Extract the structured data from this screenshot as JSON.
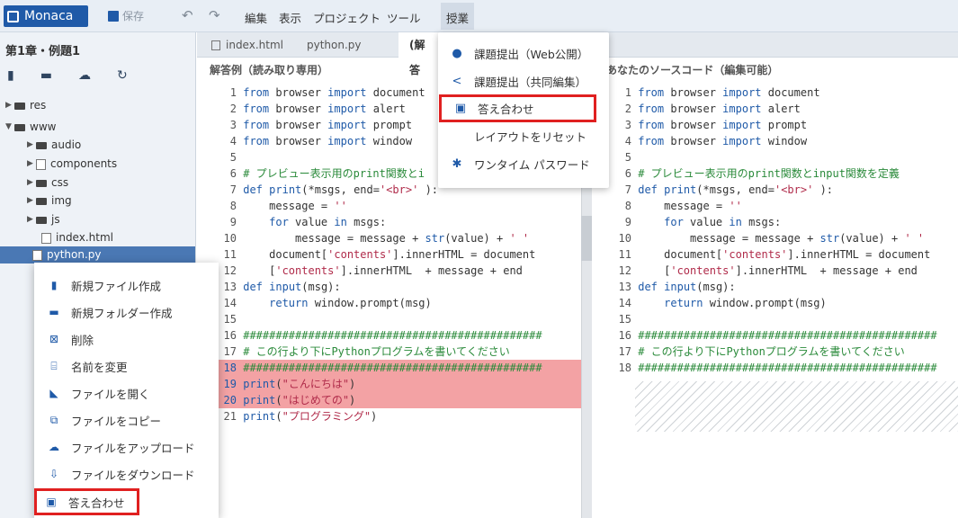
{
  "app": {
    "brand": "Monaca",
    "save_label": "保存"
  },
  "menubar": [
    "編集",
    "表示",
    "プロジェクト",
    "ツール",
    "授業"
  ],
  "sidebar": {
    "project": "第1章・例題1",
    "toolbar_icons": [
      "new-file-icon",
      "new-folder-icon",
      "upload-icon",
      "refresh-icon"
    ],
    "tree": [
      {
        "label": "res",
        "type": "folder"
      },
      {
        "label": "www",
        "type": "folder"
      },
      {
        "label": "audio",
        "type": "folder"
      },
      {
        "label": "components",
        "type": "folder"
      },
      {
        "label": "css",
        "type": "folder"
      },
      {
        "label": "img",
        "type": "folder"
      },
      {
        "label": "js",
        "type": "folder"
      },
      {
        "label": "index.html",
        "type": "file"
      },
      {
        "label": "python.py",
        "type": "file",
        "selected": true
      }
    ]
  },
  "tabs": [
    "index.html",
    "python.py",
    "(解答"
  ],
  "panes": {
    "left_title": "解答例（読み取り専用）",
    "right_title": "あなたのソースコード（編集可能）"
  },
  "code": {
    "common": [
      "from browser import document",
      "from browser import alert",
      "from browser import prompt",
      "from browser import window",
      "",
      "# プレビュー表示用のprint関数とinput関数を定義",
      "def print(*msgs, end='<br>' ):",
      "    message = ''",
      "    for value in msgs:",
      "        message = message + str(value) + ' '",
      "    document['contents'].innerHTML = document",
      "    ['contents'].innerHTML  + message + end",
      "def input(msg):",
      "    return window.prompt(msg)",
      "",
      "##############################################",
      "# この行より下にPythonプログラムを書いてください",
      "##############################################"
    ],
    "left_extra": [
      "print(\"こんにちは\")",
      "print(\"はじめての\")",
      "print(\"プログラミング\")"
    ],
    "left_line6": "# プレビュー表示用のprint関数とi"
  },
  "dropdown": [
    {
      "label": "課題提出（Web公開）",
      "icon": "share-circle-icon"
    },
    {
      "label": "課題提出（共同編集）",
      "icon": "share-icon"
    },
    {
      "label": "答え合わせ",
      "icon": "compare-icon",
      "highlight": true
    },
    {
      "label": "レイアウトをリセット",
      "icon": ""
    },
    {
      "label": "ワンタイム パスワード",
      "icon": "bug-icon"
    }
  ],
  "context_menu": [
    {
      "label": "新規ファイル作成",
      "icon": "new-file-icon"
    },
    {
      "label": "新規フォルダー作成",
      "icon": "new-folder-icon"
    },
    {
      "label": "削除",
      "icon": "delete-icon"
    },
    {
      "label": "名前を変更",
      "icon": "rename-icon"
    },
    {
      "label": "ファイルを開く",
      "icon": "open-file-icon"
    },
    {
      "label": "ファイルをコピー",
      "icon": "copy-icon"
    },
    {
      "label": "ファイルをアップロード",
      "icon": "upload-icon"
    },
    {
      "label": "ファイルをダウンロード",
      "icon": "download-icon"
    },
    {
      "label": "答え合わせ",
      "icon": "compare-icon",
      "highlight": true
    }
  ],
  "colors": {
    "accent": "#1f5aa8",
    "highlight_line": "#f3a2a4",
    "callout": "#e02020"
  }
}
